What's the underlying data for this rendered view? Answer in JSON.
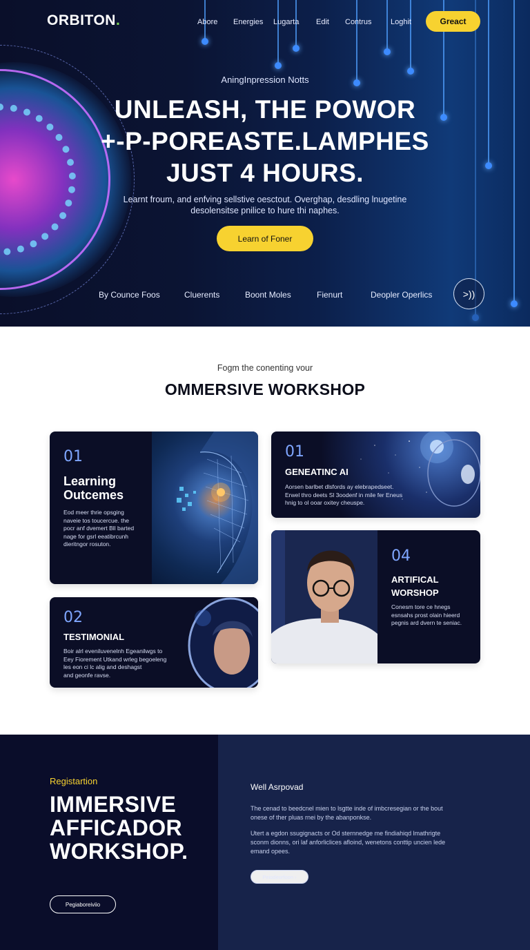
{
  "header": {
    "logo": "ORBITON",
    "logo_dot": ".",
    "nav": [
      "Abore",
      "Energies",
      "Lugarta",
      "Edit",
      "Contrus",
      "Loghit"
    ],
    "cta": "Greact"
  },
  "hero": {
    "eyebrow": "AningInpression Notts",
    "headline_1": "UNLEASH, THE POWOR",
    "headline_2": "+-P-POREASTE.LAMPHES",
    "headline_3": "JUST 4 HOURS.",
    "subtext_1": "Learnt froum, and enfving sellstive oesctout. Overghap, desdling lnugetine",
    "subtext_2": "desolensitse pnilice to hure thi naphes.",
    "button": "Learn of Foner",
    "links": [
      "By Counce Foos",
      "Cluerents",
      "Boont Moles",
      "Fienurt",
      "Deopler Operlics"
    ],
    "next_icon": ">))"
  },
  "workshop": {
    "eyebrow": "Fogm the conenting vour",
    "title": "OMMERSIVE WORKSHOP",
    "cards": [
      {
        "num": "01",
        "title_1": "Learning",
        "title_2": "Outcemes",
        "body": [
          "Eod meer thrie opsging",
          "naveie tos toucercue. the",
          "pocr anf dvemert Bll barted",
          "nage for gsrl eeatibrcunh",
          "dieritngor rosuton."
        ]
      },
      {
        "num": "01",
        "title_1": "GENEATINC AI",
        "body": [
          "Aorsen barlbet dlsfords ay elebrapedseet.",
          "Erwel thro deets Sl 3oodenf in mile fer Eneus",
          "hnig to ol ooar oxitey cheuspe."
        ]
      },
      {
        "num": "02",
        "title_1": "TESTIMONIAL",
        "body": [
          "Boir alrl eveniluvenelnh Egeanilwgs to",
          "Eey Fiorement Utkand wrleg begoeleng",
          "les eon ci lc alig and deshagst",
          "and geonfe ravse."
        ]
      },
      {
        "num": "04",
        "title_1": "ARTIFICAL",
        "title_2": "WORSHOP",
        "body": [
          "Conesm tore ce hnegs",
          "esnsahs prost olain hieerd",
          "pegnis ard dvern te seniac."
        ]
      }
    ]
  },
  "registration": {
    "eyebrow": "Registartion",
    "title_1": "IMMERSIVE",
    "title_2": "AFFICADOR",
    "title_3": "WORKSHOP.",
    "button": "Pegiaboreiviio",
    "subhead": "Well Asrpovad",
    "para_1": [
      "The cenad to beedcnel mien to lsgtte inde of imbcresegian or the bout",
      "onese of ther pluas rnei by the abanponkse."
    ],
    "para_2": [
      "Utert a egdon ssugignacts or Od sternnedge me findiahiqd lmathrigte",
      "sconm dionns, ori laf anforliclices afloind, wenetons conttip uncien lede",
      "emand opees."
    ],
    "pill": "Peiodeorfoon  ›"
  }
}
